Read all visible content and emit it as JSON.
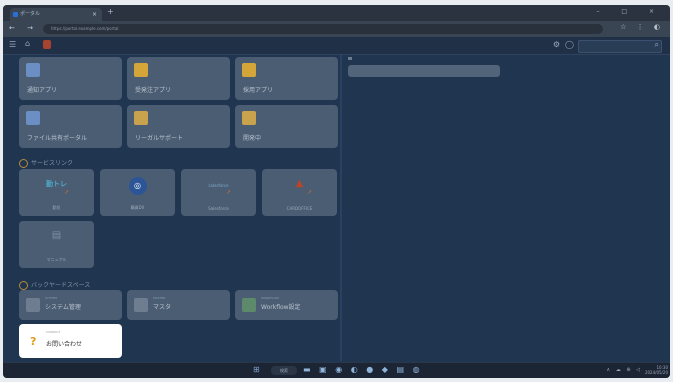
{
  "browser": {
    "tab_title": "ポータル",
    "tab_close": "×",
    "new_tab": "+",
    "window_controls": "–  □  ×",
    "nav_buttons": "← → C ⌂",
    "url": "https://portal.example.com/portal",
    "ext_icons": "☆ ⋮ ◐"
  },
  "apptop": {
    "menu_icon": "☰",
    "home_icon": "⌂",
    "settings_icon": "⚙",
    "user_icon": "◯",
    "search_icon": "⌕"
  },
  "apps": {
    "row1": [
      {
        "label": "通知アプリ",
        "color": "#6b8fc4"
      },
      {
        "label": "受発注アプリ",
        "color": "#d4a63a"
      },
      {
        "label": "採用アプリ",
        "color": "#d4a63a"
      }
    ],
    "row2": [
      {
        "label": "ファイル共有ポータル",
        "color": "#6b8fc4"
      },
      {
        "label": "リーガルサポート",
        "color": "#c9a24d"
      },
      {
        "label": "開発中",
        "color": "#c9a24d"
      }
    ]
  },
  "service_link_section": {
    "title": "サービスリンク"
  },
  "service_links": [
    {
      "label": "勤怠",
      "logo": "勤トレ"
    },
    {
      "label": "購買DX",
      "logo": "◎"
    },
    {
      "label": "Salesforce",
      "logo": "salesforce"
    },
    {
      "label": "CARDOFFICE",
      "logo": "▲"
    }
  ],
  "service_links_row2": [
    {
      "label": "マニュアル",
      "logo": "▤"
    }
  ],
  "backyard_section": {
    "title": "バックヤードスペース"
  },
  "backyard": [
    {
      "label": "システム管理",
      "tiny": "SYSTEM"
    },
    {
      "label": "マスタ",
      "tiny": "MASTER"
    },
    {
      "label": "Workflow設定",
      "tiny": "WORKFLOW"
    }
  ],
  "inquiry": {
    "icon": "?",
    "label": "お問い合わせ",
    "tiny": "CONTACT"
  },
  "taskbar": {
    "search": "検索",
    "tray": "∧ ☁ ⊕ ◁",
    "time": "10:30",
    "date": "2024/05/20"
  }
}
